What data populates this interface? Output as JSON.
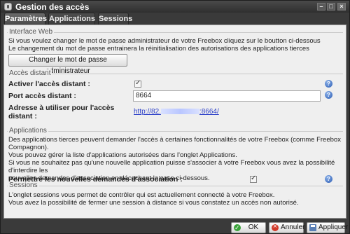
{
  "window": {
    "title": "Gestion des accès",
    "controls": {
      "minimize": "–",
      "maximize": "□",
      "close": "×"
    }
  },
  "tabs": [
    {
      "label": "Paramètres",
      "active": true
    },
    {
      "label": "Applications",
      "active": false
    },
    {
      "label": "Sessions",
      "active": false
    }
  ],
  "interface_web": {
    "legend": "Interface Web",
    "line1": "Si vous voulez changer le mot de passe administrateur de votre Freebox cliquez sur le boutton ci-dessous",
    "line2": "Le changement du mot de passe entrainera la réinitialisation des autorisations des applications tierces",
    "button_label": "Changer le mot de passe administrateur"
  },
  "acces_distant": {
    "legend": "Accès distant",
    "enable_label": "Activer l'accès distant :",
    "enable_checked": true,
    "port_label": "Port accès distant :",
    "port_value": "8664",
    "address_label_1": "Adresse à utiliser pour l'accès",
    "address_label_2": "distant :",
    "address_prefix": "http://82.",
    "address_suffix": ":8664/"
  },
  "applications": {
    "legend": "Applications",
    "line1": "Des applications tierces peuvent demander l'accès à certaines fonctionnalités de votre Freebox (comme Freebox",
    "line2": "Compagnon).",
    "line3": "Vous pouvez gérer la liste d'applications autorisées dans l'onglet Applications.",
    "line4": "Si vous ne souhaitez pas qu'une nouvelle application puisse s'associer à votre Freebox vous avez la possibilité d'interdire les",
    "line5": "nouvelles demandes d'association en décochant la case ci-dessous.",
    "allow_label": "Permettre les nouvelles demandes d'association :",
    "allow_checked": true
  },
  "sessions": {
    "legend": "Sessions",
    "line1": "L'onglet sessions vous permet de contrôler qui est actuellement connecté à votre Freebox.",
    "line2": "Vous avez la possibilité de fermer une session à distance si vous constatez un accès non autorisé."
  },
  "footer": {
    "ok_label": "OK",
    "cancel_label": "Annuler",
    "apply_label": "Appliquer"
  },
  "help_glyph": "?",
  "check_glyph": "✓",
  "colors": {
    "accent_link": "#2a3ec8",
    "help_blue": "#2f5fb5",
    "ok_green": "#3aa33a",
    "cancel_red": "#d23a2a"
  }
}
